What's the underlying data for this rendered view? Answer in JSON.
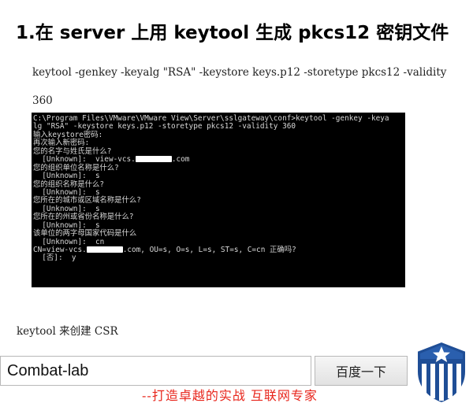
{
  "title": "1.在 server 上用 keytool 生成 pkcs12 密钥文件",
  "command": {
    "line1": "keytool -genkey -keyalg \"RSA\" -keystore keys.p12 -storetype pkcs12 -validity",
    "line2": "360"
  },
  "terminal": {
    "lines": [
      "C:\\Program Files\\VMware\\VMware View\\Server\\sslgateway\\conf>keytool -genkey -keya",
      "lg \"RSA\" -keystore keys.p12 -storetype pkcs12 -validity 360",
      "输入keystore密码:",
      "再次输入新密码:",
      "您的名字与姓氏是什么?",
      "  [Unknown]:  view-vcs.",
      "您的组织单位名称是什么?",
      "  [Unknown]:  s",
      "您的组织名称是什么?",
      "  [Unknown]:  s",
      "您所在的城市或区域名称是什么?",
      "  [Unknown]:  s",
      "您所在的州或省份名称是什么?",
      "  [Unknown]:  s",
      "该单位的两字母国家代码是什么",
      "  [Unknown]:  cn",
      "CN=view-vcs.",
      "  [否]:  y"
    ],
    "line5_suffix": ".com",
    "line16_suffix": ".com, OU=s, O=s, L=s, ST=s, C=cn 正确吗?"
  },
  "csr_text": "keytool 来创建 CSR",
  "search": {
    "value": "Combat-lab",
    "button_label": "百度一下"
  },
  "slogan": "--打造卓越的实战 互联网专家",
  "colors": {
    "slogan": "#e8261c",
    "logo": "#1f4e96"
  }
}
